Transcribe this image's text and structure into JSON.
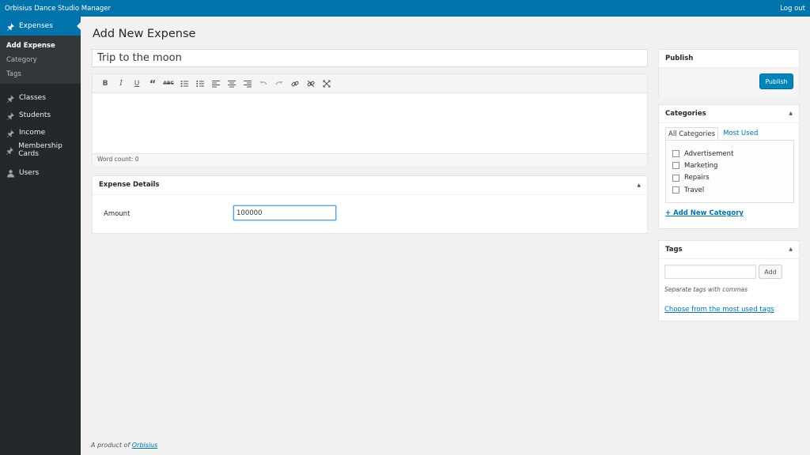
{
  "adminbar": {
    "site_name": "Orbisius Dance Studio Manager",
    "logout": "Log out"
  },
  "sidebar": {
    "current": {
      "label": "Expenses",
      "icon": "pin-icon"
    },
    "submenu": [
      "Add Expense",
      "Category",
      "Tags"
    ],
    "items": [
      {
        "label": "Classes",
        "icon": "pin-icon"
      },
      {
        "label": "Students",
        "icon": "pin-icon"
      },
      {
        "label": "Income",
        "icon": "pin-icon"
      },
      {
        "label": "Membership Cards",
        "icon": "pin-icon"
      },
      {
        "label": "Users",
        "icon": "users-icon"
      }
    ]
  },
  "main": {
    "page_title": "Add New Expense",
    "title_value": "Trip to the moon",
    "editor": {
      "toolbar": [
        "bold-icon",
        "italic-icon",
        "underline-icon",
        "blockquote-icon",
        "strikethrough-icon",
        "bullet-list-icon",
        "numbered-list-icon",
        "align-left-icon",
        "align-center-icon",
        "align-right-icon",
        "undo-icon",
        "redo-icon",
        "link-icon",
        "unlink-icon",
        "fullscreen-icon"
      ],
      "word_count": "Word count: 0"
    },
    "expense_details": {
      "title": "Expense Details",
      "amount_label": "Amount",
      "amount_value": "100000"
    }
  },
  "publish": {
    "title": "Publish",
    "button": "Publish"
  },
  "categories": {
    "title": "Categories",
    "tab_all": "All Categories",
    "tab_most_used": "Most Used",
    "items": [
      "Advertisement",
      "Marketing",
      "Repairs",
      "Travel"
    ],
    "add_link": "+ Add New Category"
  },
  "tags": {
    "title": "Tags",
    "add_button": "Add",
    "help": "Separate tags with commas",
    "choose_link": "Choose from the most used tags"
  },
  "footer": {
    "prefix": "A product of",
    "link": "Orbisius"
  },
  "colors": {
    "accent": "#0073aa",
    "sidebar": "#23282d",
    "background": "#f1f1f1"
  }
}
